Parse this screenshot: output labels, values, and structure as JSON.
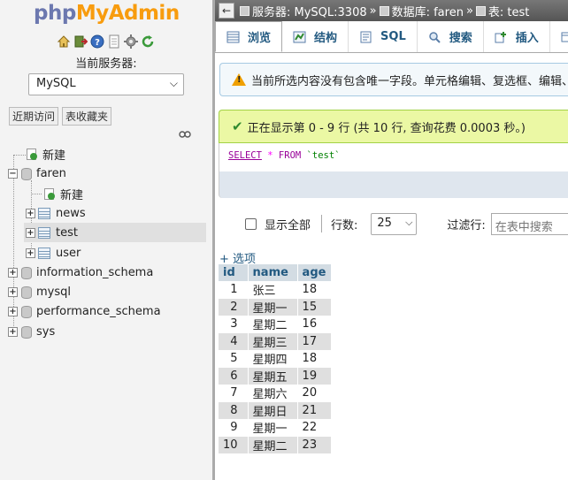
{
  "logo": {
    "php": "php",
    "my": "My",
    "admin": "Admin"
  },
  "nav": {
    "icons": [
      "home-icon",
      "exit-icon",
      "help-icon",
      "docs-icon",
      "settings-icon",
      "reload-icon"
    ],
    "server_label": "当前服务器:",
    "server_value": "MySQL",
    "tabs": [
      "近期访问",
      "表收藏夹"
    ],
    "tree": {
      "new_root": "新建",
      "db_faren": "faren",
      "faren_new": "新建",
      "tables": [
        "news",
        "test",
        "user"
      ],
      "selected_table": "test",
      "databases": [
        "information_schema",
        "mysql",
        "performance_schema",
        "sys"
      ]
    }
  },
  "breadcrumb": {
    "server": "服务器: MySQL:3308",
    "database": "数据库: faren",
    "table": "表: test",
    "separator": "»"
  },
  "toolbar": {
    "tabs": [
      "浏览",
      "结构",
      "SQL",
      "搜索",
      "插入"
    ],
    "active": "浏览"
  },
  "warning": {
    "text": "当前所选内容没有包含唯一字段。单元格编辑、复选框、编辑、"
  },
  "success": {
    "text": "正在显示第 0 - 9 行 (共 10 行, 查询花费 0.0003 秒。)"
  },
  "sql": {
    "select": "SELECT",
    "star": "*",
    "from": "FROM",
    "table": "`test`"
  },
  "controls": {
    "show_all": "显示全部",
    "rows_label": "行数:",
    "rows_value": "25",
    "filter_label": "过滤行:",
    "filter_placeholder": "在表中搜索"
  },
  "options_link": "+ 选项",
  "table": {
    "columns": [
      "id",
      "name",
      "age"
    ],
    "rows": [
      [
        "1",
        "张三",
        "18"
      ],
      [
        "2",
        "星期一",
        "15"
      ],
      [
        "3",
        "星期二",
        "16"
      ],
      [
        "4",
        "星期三",
        "17"
      ],
      [
        "5",
        "星期四",
        "18"
      ],
      [
        "6",
        "星期五",
        "19"
      ],
      [
        "7",
        "星期六",
        "20"
      ],
      [
        "8",
        "星期日",
        "21"
      ],
      [
        "9",
        "星期一",
        "22"
      ],
      [
        "10",
        "星期二",
        "23"
      ]
    ]
  },
  "colors": {
    "link": "#235a81",
    "header_bg": "#d3dce3",
    "success_bg": "#ebf8a4",
    "warning_bg": "#f3f8fb"
  }
}
